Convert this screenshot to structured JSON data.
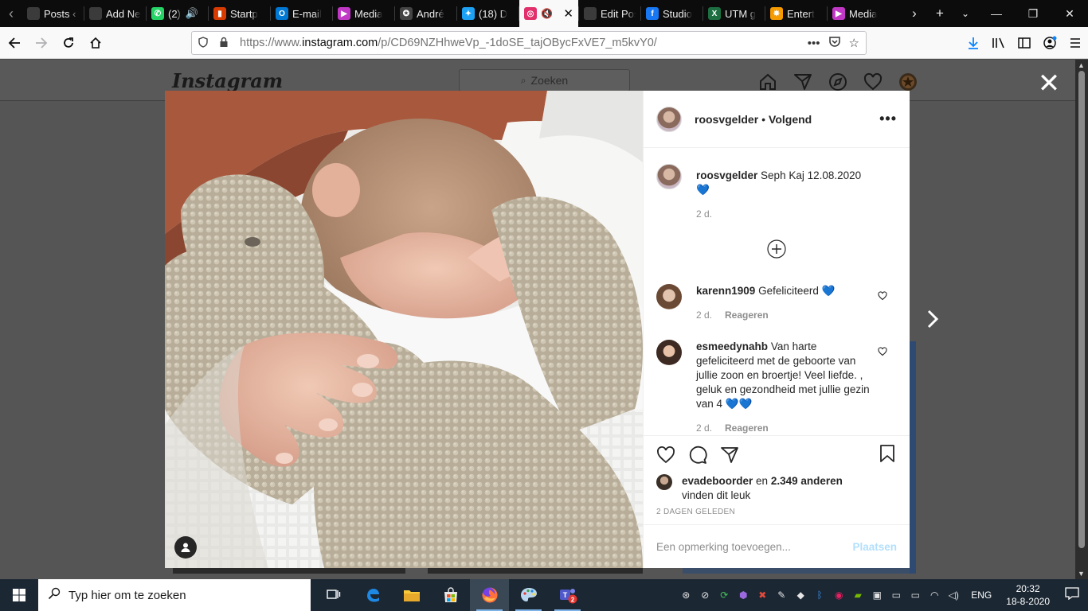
{
  "browser": {
    "tabs": [
      {
        "label": "Posts ‹ Sh",
        "icon_color": "#3b3b3b",
        "icon_glyph": ""
      },
      {
        "label": "Add New",
        "icon_color": "#3b3b3b",
        "icon_glyph": ""
      },
      {
        "label": "(2)",
        "icon_color": "#25d366",
        "icon_glyph": "✆"
      },
      {
        "label": "Startp",
        "icon_color": "#d83b01",
        "icon_glyph": "▮"
      },
      {
        "label": "E-mail",
        "icon_color": "#0078d4",
        "icon_glyph": "O"
      },
      {
        "label": "Media",
        "icon_color": "#c238c6",
        "icon_glyph": "▶"
      },
      {
        "label": "André",
        "icon_color": "#444444",
        "icon_glyph": "✪"
      },
      {
        "label": "(18) D",
        "icon_color": "#1da1f2",
        "icon_glyph": "✦"
      },
      {
        "label": "",
        "icon_color": "#e1306c",
        "icon_glyph": "◎",
        "active": true
      },
      {
        "label": "Edit Post",
        "icon_color": "#3b3b3b",
        "icon_glyph": ""
      },
      {
        "label": "Studio",
        "icon_color": "#1877f2",
        "icon_glyph": "f"
      },
      {
        "label": "UTM g",
        "icon_color": "#1d6f42",
        "icon_glyph": "X"
      },
      {
        "label": "Entert",
        "icon_color": "#f59a00",
        "icon_glyph": "✸"
      },
      {
        "label": "Media",
        "icon_color": "#c238c6",
        "icon_glyph": "▶"
      }
    ],
    "url": {
      "prefix": "https://www.",
      "host": "instagram.com",
      "path": "/p/CD69NZHhweVp_-1doSE_tajOBycFxVE7_m5kvY0/"
    }
  },
  "instagram": {
    "logo": "Instagram",
    "search_placeholder": "Zoeken"
  },
  "post": {
    "author": "roosvgelder",
    "follow_status": "Volgend",
    "caption": {
      "user": "roosvgelder",
      "text": "Seph Kaj 12.08.2020 💙",
      "time": "2 d."
    },
    "comments": [
      {
        "user": "karenn1909",
        "text": "Gefeliciteerd 💙",
        "time": "2 d.",
        "reply": "Reageren"
      },
      {
        "user": "esmeedynahb",
        "text": "Van harte gefeliciteerd met de geboorte van jullie zoon en broertje! Veel liefde. , geluk en gezondheid met jullie gezin van 4 💙💙",
        "time": "2 d.",
        "reply": "Reageren"
      }
    ],
    "likes": {
      "first_user": "evadeboorder",
      "conjunction": "en",
      "others": "2.349 anderen",
      "suffix": "vinden dit leuk"
    },
    "posted_ago": "2 DAGEN GELEDEN",
    "comment_placeholder": "Een opmerking toevoegen...",
    "post_button": "Plaatsen"
  },
  "taskbar": {
    "search_placeholder": "Typ hier om te zoeken",
    "language": "ENG",
    "time": "20:32",
    "date": "18-8-2020"
  }
}
